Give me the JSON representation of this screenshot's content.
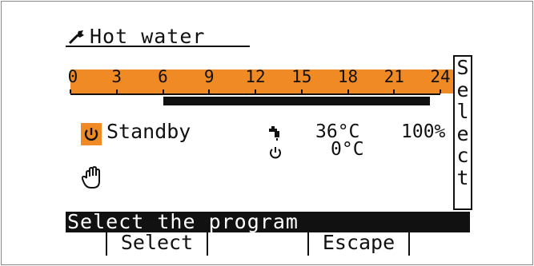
{
  "header": {
    "title": "Hot water",
    "icon": "wrench-icon"
  },
  "timeline": {
    "hours": [
      "0",
      "3",
      "6",
      "9",
      "12",
      "15",
      "18",
      "21",
      "24"
    ],
    "active_program_range": [
      6,
      23
    ],
    "highlight_color": "#f08a24"
  },
  "side_button": {
    "label": "Select"
  },
  "status": {
    "mode_icon": "power-icon",
    "mode_label": "Standby",
    "tap_icon": "tap-icon",
    "temperature": "36°C",
    "percent": "100%",
    "power_icon_small": "power-icon",
    "setpoint": "0°C",
    "manual_icon": "hand-icon"
  },
  "message": {
    "text": "Select the program"
  },
  "softkeys": {
    "k1": "",
    "k2": "Select",
    "k3": "",
    "k4": "Escape",
    "k5": ""
  }
}
